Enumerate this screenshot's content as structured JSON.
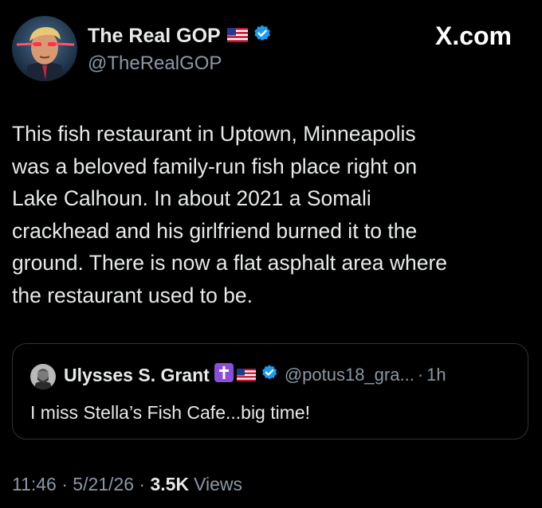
{
  "post": {
    "author": {
      "name": "The Real GOP",
      "handle": "@TheRealGOP",
      "avatar_icon": "glowing-eyes-portrait"
    },
    "source_logo": "X.com",
    "text": "This fish restaurant in Uptown, Minneapolis\nwas a beloved family-run fish place right on\nLake Calhoun. In about 2021 a Somali\ncrackhead and his girlfriend burned it to the\nground. There is now a flat asphalt area where\nthe restaurant used to be.",
    "timestamp": "11:46 · 5/21/26 · ",
    "views_count": "3.5K",
    "views_label": "Views"
  },
  "quote": {
    "name": "Ulysses S. Grant",
    "handle": "@potus18_gra...",
    "separator": "·",
    "time": "1h",
    "text": "I miss Stella’s Fish Cafe...big time!",
    "avatar_icon": "bearded-portrait"
  },
  "colors": {
    "background": "#000000",
    "text": "#e7e9ea",
    "secondary": "#8b98a5",
    "verified": "#1d9bf0",
    "border": "#2f3336",
    "cross_badge": "#8a4fd6"
  }
}
